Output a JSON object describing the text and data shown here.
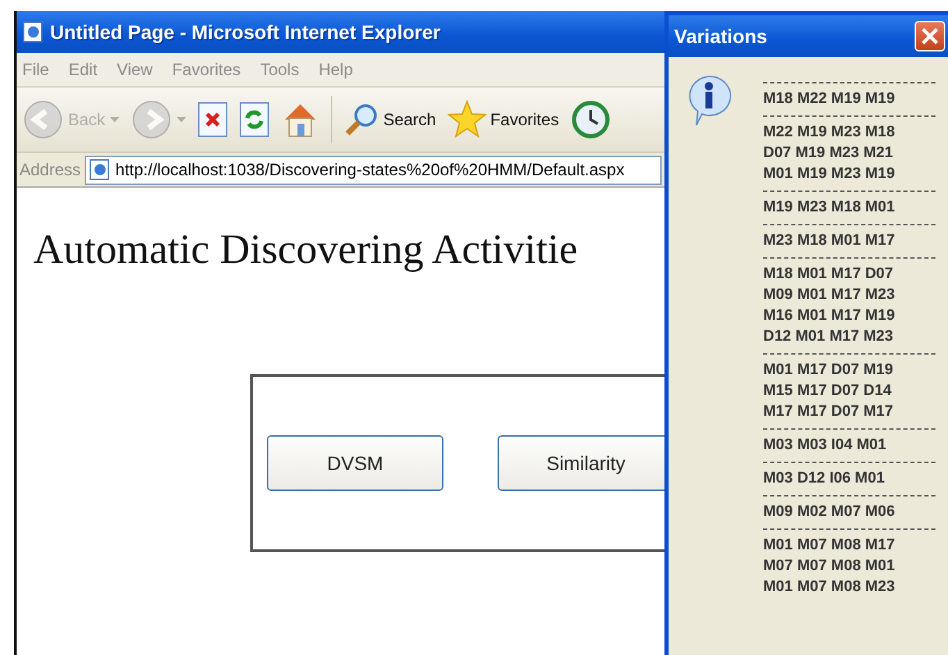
{
  "browser": {
    "title": "Untitled Page - Microsoft Internet Explorer",
    "menu": [
      "File",
      "Edit",
      "View",
      "Favorites",
      "Tools",
      "Help"
    ],
    "toolbar": [
      {
        "kind": "back",
        "label": "Back",
        "disabled": true
      },
      {
        "kind": "forward",
        "disabled": true
      },
      {
        "kind": "stop",
        "disabled": false
      },
      {
        "kind": "refresh",
        "disabled": false
      },
      {
        "kind": "home",
        "disabled": false
      },
      {
        "kind": "search",
        "label": "Search",
        "disabled": false
      },
      {
        "kind": "favorites",
        "label": "Favorites",
        "disabled": false
      },
      {
        "kind": "history",
        "disabled": false
      }
    ],
    "address": {
      "label": "Address",
      "url": "http://localhost:1038/Discovering-states%20of%20HMM/Default.aspx"
    }
  },
  "page": {
    "heading": "Automatic Discovering Activitie",
    "buttons": [
      "DVSM",
      "Similarity"
    ]
  },
  "dialog": {
    "title": "Variations",
    "groups": [
      [
        "M18 M22 M19 M19"
      ],
      [
        "M22 M19 M23 M18",
        "D07 M19 M23 M21",
        "M01 M19 M23 M19"
      ],
      [
        "M19 M23 M18 M01"
      ],
      [
        "M23 M18 M01 M17"
      ],
      [
        "M18 M01 M17 D07",
        "M09 M01 M17 M23",
        "M16 M01 M17 M19",
        "D12 M01 M17 M23"
      ],
      [
        "M01 M17 D07 M19",
        "M15 M17 D07 D14",
        "M17 M17 D07 M17"
      ],
      [
        "M03 M03 I04 M01"
      ],
      [
        "M03 D12 I06 M01"
      ],
      [
        "M09 M02 M07 M06"
      ],
      [
        "M01 M07 M08 M17",
        "M07 M07 M08 M01",
        "M01 M07 M08 M23"
      ]
    ]
  }
}
